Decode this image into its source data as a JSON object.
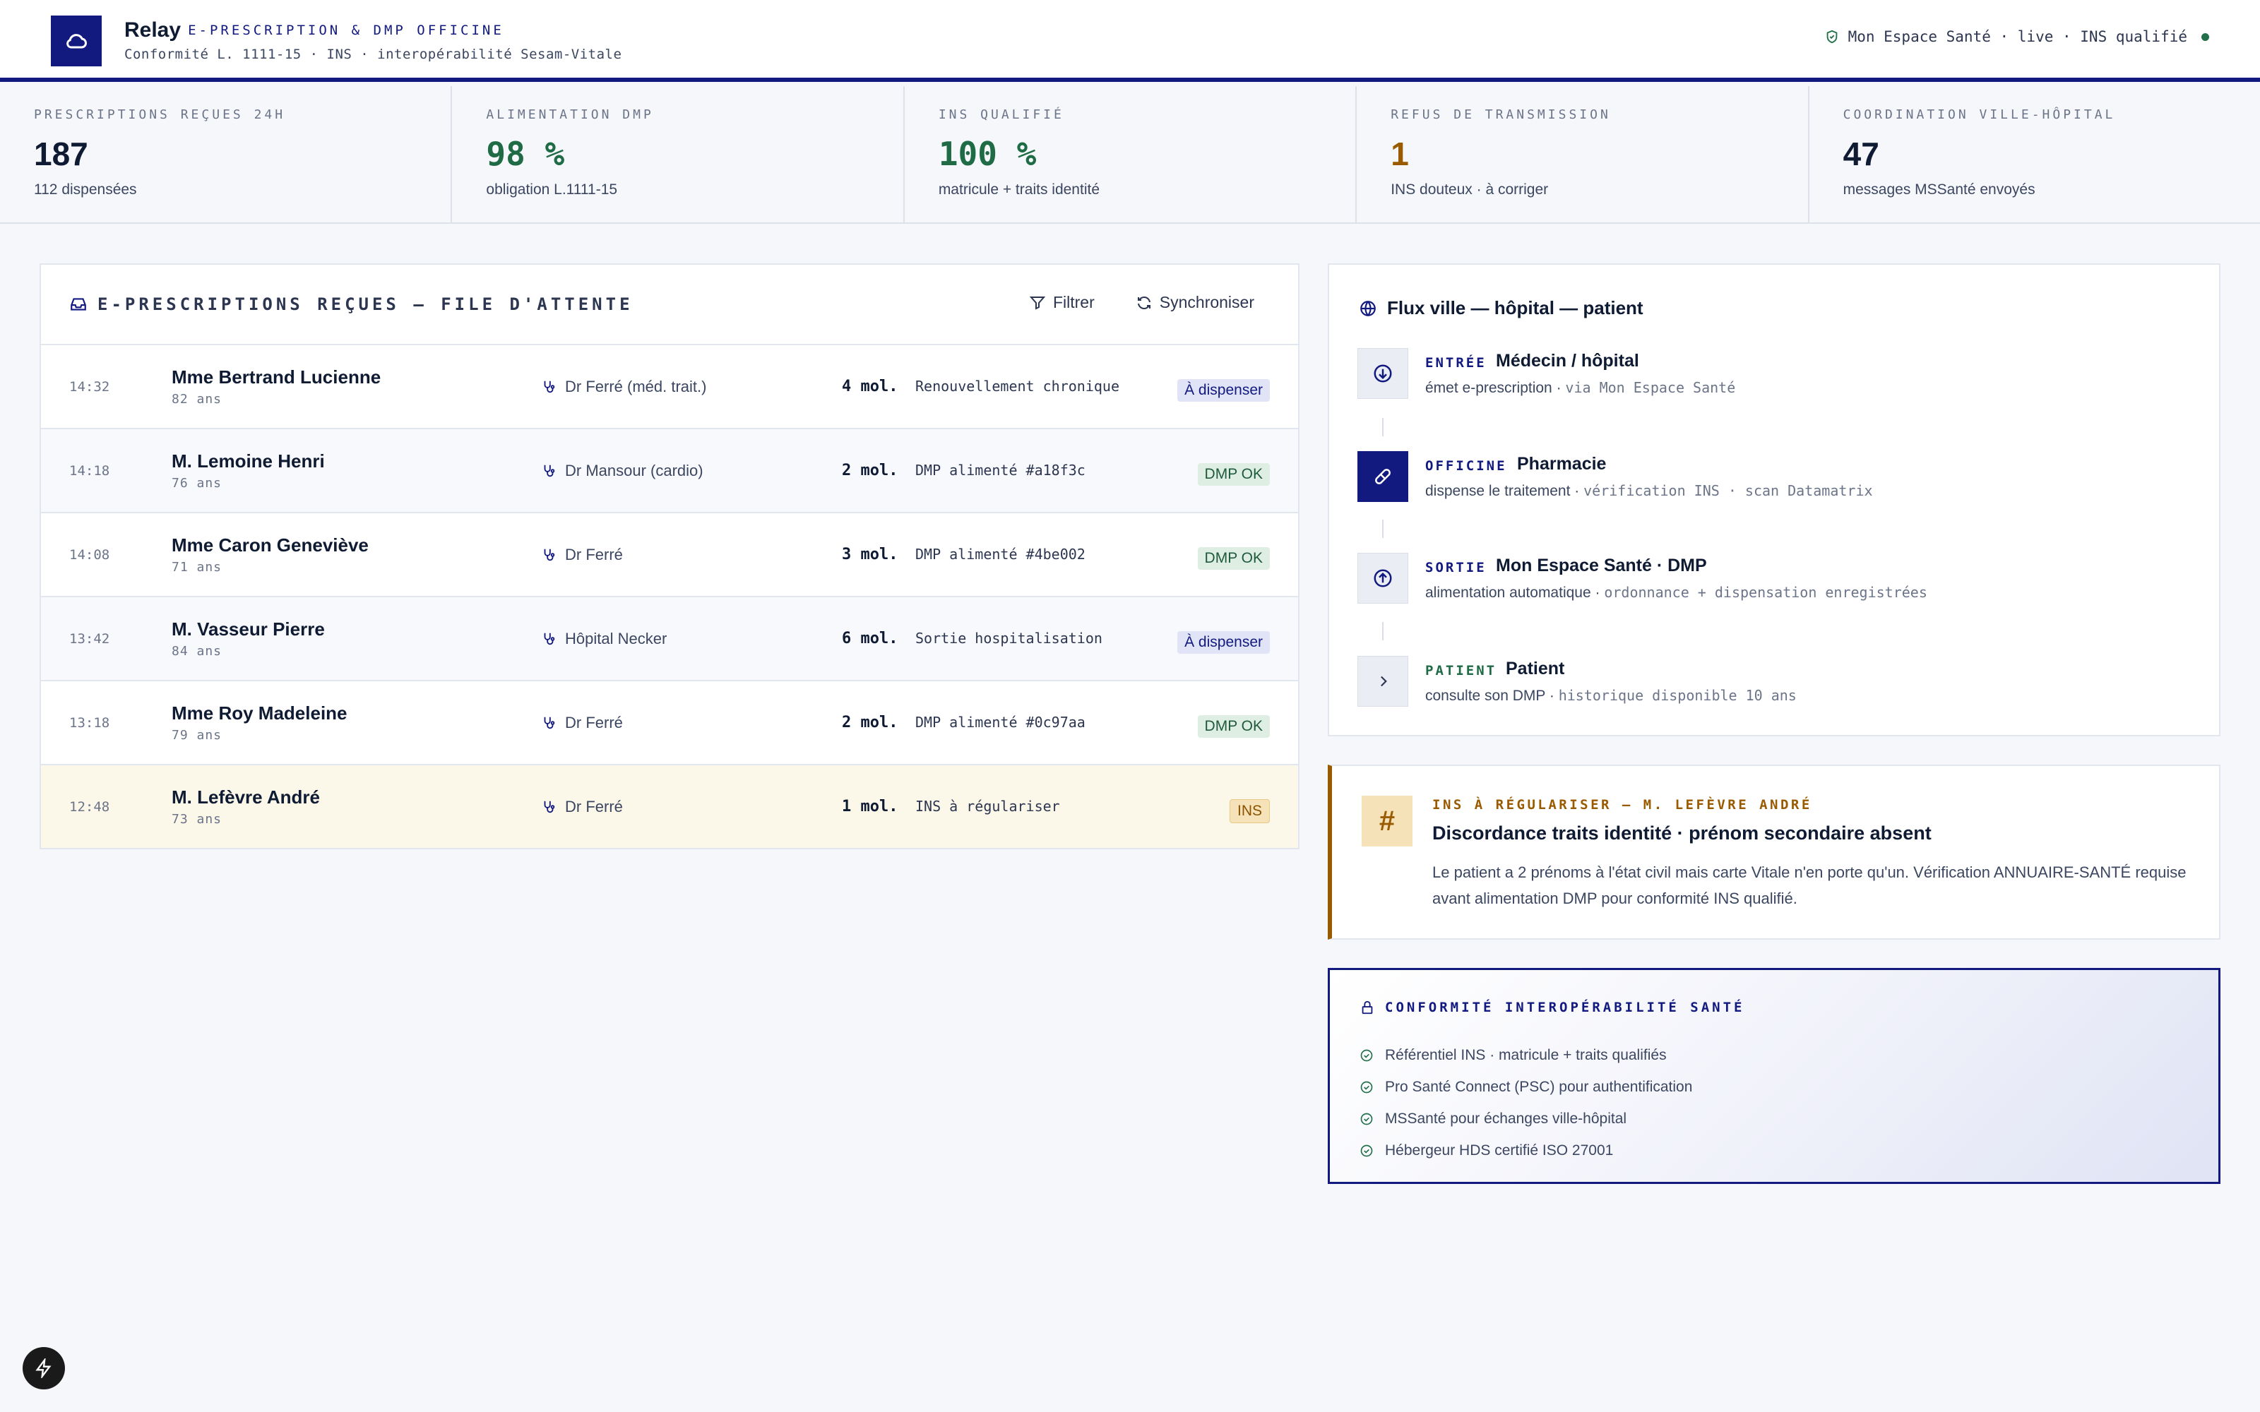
{
  "header": {
    "app_name": "Relay",
    "tagline": "E-PRESCRIPTION & DMP OFFICINE",
    "subtitle": "Conformité L. 1111-15 · INS · interopérabilité Sesam-Vitale",
    "status": "Mon Espace Santé · live · INS qualifié",
    "logo_icon": "cloud-icon",
    "accent": "#121a80"
  },
  "kpis": [
    {
      "label": "PRESCRIPTIONS REÇUES 24H",
      "value": "187",
      "caption": "112 dispensées",
      "color": "#0f1b33"
    },
    {
      "label": "ALIMENTATION DMP",
      "value": "98 %",
      "caption": "obligation L.1111-15",
      "color": "#1f6b45"
    },
    {
      "label": "INS QUALIFIÉ",
      "value": "100 %",
      "caption": "matricule + traits identité",
      "color": "#1f6b45"
    },
    {
      "label": "REFUS DE TRANSMISSION",
      "value": "1",
      "caption": "INS douteux · à corriger",
      "color": "#9a5b00"
    },
    {
      "label": "COORDINATION VILLE-HÔPITAL",
      "value": "47",
      "caption": "messages MSSanté envoyés",
      "color": "#0f1b33"
    }
  ],
  "queue": {
    "title": "E-PRESCRIPTIONS REÇUES — FILE D'ATTENTE",
    "filter_label": "Filtrer",
    "sync_label": "Synchroniser",
    "rows": [
      {
        "time": "14:32",
        "name": "Mme Bertrand Lucienne",
        "age": "82 ans",
        "doctor": "Dr Ferré (méd. trait.)",
        "mol": "4 mol.",
        "note": "Renouvellement chronique",
        "badge": "À dispenser",
        "badge_type": "blue"
      },
      {
        "time": "14:18",
        "name": "M. Lemoine Henri",
        "age": "76 ans",
        "doctor": "Dr Mansour (cardio)",
        "mol": "2 mol.",
        "note": "DMP alimenté #a18f3c",
        "badge": "DMP OK",
        "badge_type": "green"
      },
      {
        "time": "14:08",
        "name": "Mme Caron Geneviève",
        "age": "71 ans",
        "doctor": "Dr Ferré",
        "mol": "3 mol.",
        "note": "DMP alimenté #4be002",
        "badge": "DMP OK",
        "badge_type": "green"
      },
      {
        "time": "13:42",
        "name": "M. Vasseur Pierre",
        "age": "84 ans",
        "doctor": "Hôpital Necker",
        "mol": "6 mol.",
        "note": "Sortie hospitalisation",
        "badge": "À dispenser",
        "badge_type": "blue"
      },
      {
        "time": "13:18",
        "name": "Mme Roy Madeleine",
        "age": "79 ans",
        "doctor": "Dr Ferré",
        "mol": "2 mol.",
        "note": "DMP alimenté #0c97aa",
        "badge": "DMP OK",
        "badge_type": "green"
      },
      {
        "time": "12:48",
        "name": "M. Lefèvre André",
        "age": "73 ans",
        "doctor": "Dr Ferré",
        "mol": "1 mol.",
        "note": "INS à régulariser",
        "badge": "INS",
        "badge_type": "amber"
      }
    ]
  },
  "flux": {
    "title": "Flux ville — hôpital — patient",
    "steps": [
      {
        "kind": "ENTRÉE",
        "title": "Médecin / hôpital",
        "desc": "émet e-prescription",
        "meta": "via Mon Espace Santé",
        "icon": "arrow-down-circle-icon"
      },
      {
        "kind": "OFFICINE",
        "title": "Pharmacie",
        "desc": "dispense le traitement",
        "meta": "vérification INS · scan Datamatrix",
        "icon": "pill-icon"
      },
      {
        "kind": "SORTIE",
        "title": "Mon Espace Santé · DMP",
        "desc": "alimentation automatique",
        "meta": "ordonnance + dispensation enregistrées",
        "icon": "arrow-up-circle-icon"
      },
      {
        "kind": "PATIENT",
        "title": "Patient",
        "desc": "consulte son DMP",
        "meta": "historique disponible 10 ans",
        "icon": "chevron-right-icon"
      }
    ]
  },
  "ins_alert": {
    "kicker": "INS À RÉGULARISER — M. LEFÈVRE ANDRÉ",
    "title": "Discordance traits identité · prénom secondaire absent",
    "body": "Le patient a 2 prénoms à l'état civil mais carte Vitale n'en porte qu'un. Vérification ANNUAIRE-SANTÉ requise avant alimentation DMP pour conformité INS qualifié.",
    "icon": "hash-icon"
  },
  "conformity": {
    "title": "CONFORMITÉ INTEROPÉRABILITÉ SANTÉ",
    "items": [
      "Référentiel INS · matricule + traits qualifiés",
      "Pro Santé Connect (PSC) pour authentification",
      "MSSanté pour échanges ville-hôpital",
      "Hébergeur HDS certifié ISO 27001"
    ]
  }
}
